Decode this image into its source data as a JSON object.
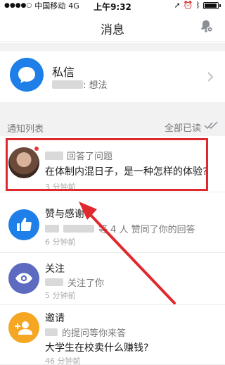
{
  "status_bar": {
    "carrier": "中国移动",
    "network": "4G",
    "time": "上午9:32",
    "battery_percent": 90
  },
  "nav": {
    "title": "消息",
    "bell_icon": "bell-gear-icon"
  },
  "direct_messages": {
    "title": "私信",
    "preview_suffix": ": 想法",
    "icon": "chat-bubble-icon",
    "icon_color": "#1e7fe8"
  },
  "notifications": {
    "header": "通知列表",
    "mark_all_read": "全部已读",
    "items": [
      {
        "type": "answer",
        "action": "回答了问题",
        "question": "在体制内混日子，是一种怎样的体验?",
        "time": "3 分钟前",
        "unread": true
      },
      {
        "type": "like",
        "label": "赞与感谢",
        "text": "等 4 人 赞同了你的回答",
        "time": "6 分钟前",
        "icon": "thumbs-up-icon",
        "icon_color": "#1e7fe8"
      },
      {
        "type": "follow",
        "label": "关注",
        "text": "关注了你",
        "time": "5 分钟前",
        "icon": "eye-icon",
        "icon_color": "#5c6bc0"
      },
      {
        "type": "invite",
        "label": "邀请",
        "text": "的提问等你来答",
        "question": "大学生在校卖什么赚钱?",
        "time": "46 分钟前",
        "icon": "add-person-icon",
        "icon_color": "#f5a623"
      }
    ]
  },
  "annotation": {
    "highlight_color": "#e0292c"
  }
}
